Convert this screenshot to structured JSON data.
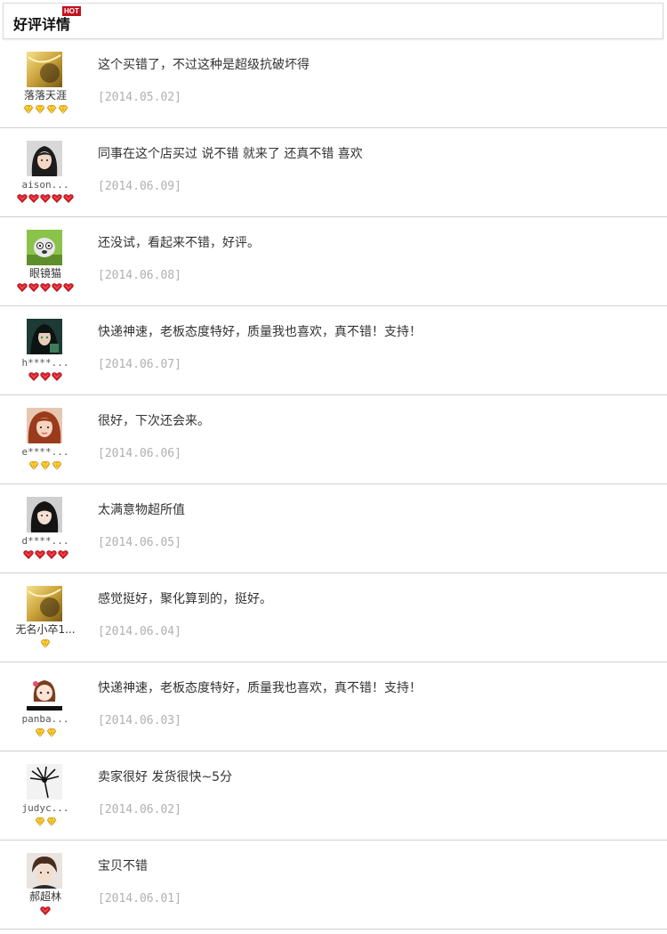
{
  "header": {
    "title": "好评详情",
    "badge": "HOT"
  },
  "colors": {
    "badge": "#c1121f",
    "date": "#b0b0b0",
    "divider": "#cfcfcf",
    "gem_yellow": "#f0b400",
    "gem_red": "#e0202a"
  },
  "reviews": [
    {
      "user": "落落天涯",
      "avatar": "gold-icon-avatar",
      "rank_icon": "yellow-diamond-icon",
      "rank_count": 4,
      "comment": "这个买错了，不过这种是超级抗破坏得",
      "date": "[2014.05.02]"
    },
    {
      "user": "aison...",
      "avatar": "girl-photo-avatar",
      "rank_icon": "red-heart-gem-icon",
      "rank_count": 5,
      "comment": "同事在这个店买过 说不错 就来了 还真不错 喜欢",
      "date": "[2014.06.09]"
    },
    {
      "user": "眼镜猫",
      "avatar": "cartoon-dog-avatar",
      "rank_icon": "red-heart-gem-icon",
      "rank_count": 5,
      "comment": "还没试，看起来不错，好评。",
      "date": "[2014.06.08]"
    },
    {
      "user": "h****...",
      "avatar": "anime-character-avatar",
      "rank_icon": "red-heart-gem-icon",
      "rank_count": 3,
      "comment": "快递神速，老板态度特好，质量我也喜欢，真不错！支持！",
      "date": "[2014.06.07]"
    },
    {
      "user": "e****...",
      "avatar": "red-hair-girl-avatar",
      "rank_icon": "yellow-diamond-icon",
      "rank_count": 3,
      "comment": "很好，下次还会来。",
      "date": "[2014.06.06]"
    },
    {
      "user": "d****...",
      "avatar": "dark-hair-girl-avatar",
      "rank_icon": "red-heart-gem-icon",
      "rank_count": 4,
      "comment": "太满意物超所值",
      "date": "[2014.06.05]"
    },
    {
      "user": "无名小卒1...",
      "avatar": "gold-icon-avatar",
      "rank_icon": "yellow-diamond-icon",
      "rank_count": 1,
      "comment": "感觉挺好，聚化算到的，挺好。",
      "date": "[2014.06.04]"
    },
    {
      "user": "panba...",
      "avatar": "cartoon-girl-avatar",
      "rank_icon": "yellow-diamond-icon",
      "rank_count": 2,
      "comment": "快递神速，老板态度特好，质量我也喜欢，真不错！支持！",
      "date": "[2014.06.03]"
    },
    {
      "user": "judyc...",
      "avatar": "black-flower-avatar",
      "rank_icon": "yellow-diamond-icon",
      "rank_count": 2,
      "comment": "卖家很好 发货很快~5分",
      "date": "[2014.06.02]"
    },
    {
      "user": "郝超林",
      "avatar": "young-man-avatar",
      "rank_icon": "red-heart-gem-icon",
      "rank_count": 1,
      "comment": "宝贝不错",
      "date": "[2014.06.01]"
    }
  ]
}
